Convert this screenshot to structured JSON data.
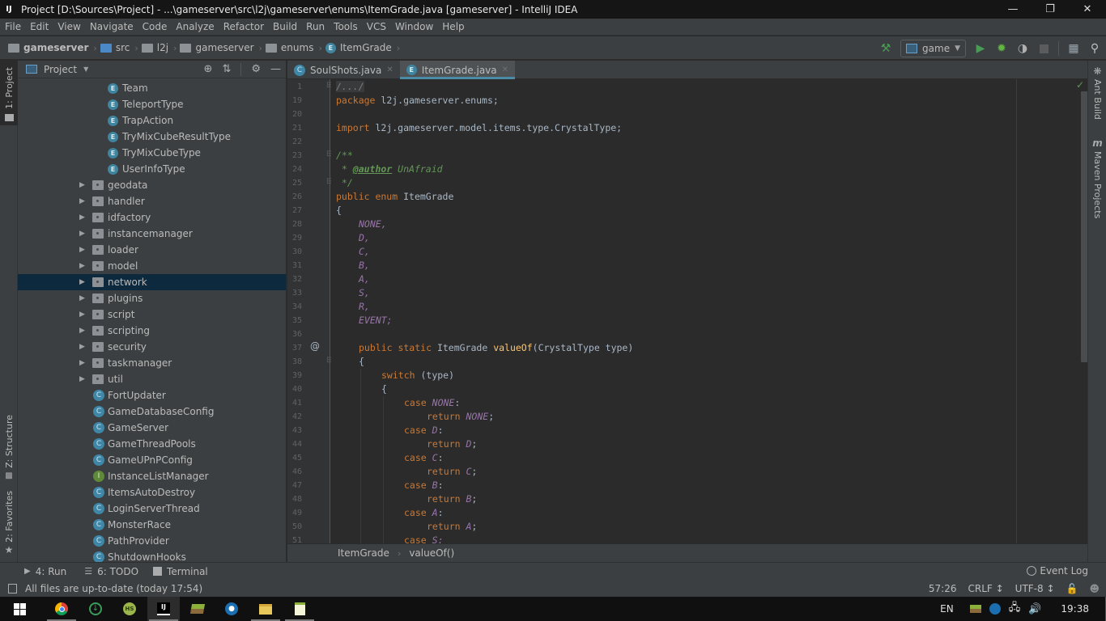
{
  "window": {
    "app_icon": "IJ",
    "title": "Project [D:\\Sources\\Project] - ...\\gameserver\\src\\l2j\\gameserver\\enums\\ItemGrade.java [gameserver] - IntelliJ IDEA",
    "controls": {
      "minimize": "—",
      "restore": "❐",
      "close": "✕"
    }
  },
  "menu": [
    {
      "label": "File"
    },
    {
      "label": "Edit"
    },
    {
      "label": "View"
    },
    {
      "label": "Navigate"
    },
    {
      "label": "Code"
    },
    {
      "label": "Analyze"
    },
    {
      "label": "Refactor"
    },
    {
      "label": "Build"
    },
    {
      "label": "Run"
    },
    {
      "label": "Tools"
    },
    {
      "label": "VCS"
    },
    {
      "label": "Window"
    },
    {
      "label": "Help"
    }
  ],
  "navbar": {
    "crumbs": [
      "gameserver",
      "src",
      "l2j",
      "gameserver",
      "enums",
      "ItemGrade"
    ],
    "run_config": "game"
  },
  "left_stripe": {
    "project": "1: Project",
    "structure": "Z: Structure",
    "favorites": "2: Favorites"
  },
  "project_panel": {
    "title": "Project",
    "enum_items": [
      "Team",
      "TeleportType",
      "TrapAction",
      "TryMixCubeResultType",
      "TryMixCubeType",
      "UserInfoType"
    ],
    "packages": [
      "geodata",
      "handler",
      "idfactory",
      "instancemanager",
      "loader",
      "model",
      "network",
      "plugins",
      "script",
      "scripting",
      "security",
      "taskmanager",
      "util"
    ],
    "selected_package": "network",
    "classes": [
      {
        "name": "FortUpdater",
        "kind": "C"
      },
      {
        "name": "GameDatabaseConfig",
        "kind": "C"
      },
      {
        "name": "GameServer",
        "kind": "C"
      },
      {
        "name": "GameThreadPools",
        "kind": "C"
      },
      {
        "name": "GameUPnPConfig",
        "kind": "C"
      },
      {
        "name": "InstanceListManager",
        "kind": "I"
      },
      {
        "name": "ItemsAutoDestroy",
        "kind": "C"
      },
      {
        "name": "LoginServerThread",
        "kind": "C"
      },
      {
        "name": "MonsterRace",
        "kind": "C"
      },
      {
        "name": "PathProvider",
        "kind": "C"
      },
      {
        "name": "ShutdownHooks",
        "kind": "C"
      }
    ]
  },
  "editor": {
    "tabs": [
      {
        "label": "SoulShots.java",
        "kind": "C",
        "active": false
      },
      {
        "label": "ItemGrade.java",
        "kind": "E",
        "active": true
      }
    ],
    "line_numbers": [
      "1",
      "19",
      "20",
      "21",
      "22",
      "23",
      "24",
      "25",
      "26",
      "27",
      "28",
      "29",
      "30",
      "31",
      "32",
      "33",
      "34",
      "35",
      "36",
      "37",
      "38",
      "39",
      "40",
      "41",
      "42",
      "43",
      "44",
      "45",
      "46",
      "47",
      "48",
      "49",
      "50",
      "51"
    ],
    "code": {
      "l1": "/.../",
      "l19_kw": "package",
      "l19_rest": " l2j.gameserver.enums;",
      "l21_kw": "import",
      "l21_rest": " l2j.gameserver.model.items.type.CrystalType;",
      "l23": "/**",
      "l24_star": " * ",
      "l24_tag": "@author",
      "l24_name": " UnAfraid",
      "l25": " */",
      "l26_kw": "public enum",
      "l26_rest": " ItemGrade",
      "l27": "{",
      "enum_constants": [
        "NONE,",
        "D,",
        "C,",
        "B,",
        "A,",
        "S,",
        "R,",
        "EVENT;"
      ],
      "l37_kw": "public static",
      "l37_type": " ItemGrade ",
      "l37_fn": "valueOf",
      "l37_rest": "(CrystalType type)",
      "l38": "{",
      "l39_kw": "switch",
      "l39_rest": " (type)",
      "l40": "{",
      "cases": [
        {
          "case_kw": "case",
          "const": "NONE",
          "ret_kw": "return",
          "ret": "NONE"
        },
        {
          "case_kw": "case",
          "const": "D",
          "ret_kw": "return",
          "ret": "D"
        },
        {
          "case_kw": "case",
          "const": "C",
          "ret_kw": "return",
          "ret": "C"
        },
        {
          "case_kw": "case",
          "const": "B",
          "ret_kw": "return",
          "ret": "B"
        },
        {
          "case_kw": "case",
          "const": "A",
          "ret_kw": "return",
          "ret": "A"
        }
      ],
      "l51_kw": "case",
      "l51_const": "S:"
    },
    "breadcrumb": [
      "ItemGrade",
      "valueOf()"
    ]
  },
  "right_stripe": {
    "ant": "Ant Build",
    "maven": "Maven Projects"
  },
  "tool_windows": {
    "run": "4: Run",
    "todo": "6: TODO",
    "terminal": "Terminal",
    "event_log": "Event Log"
  },
  "status": {
    "message": "All files are up-to-date (today 17:54)",
    "position": "57:26",
    "line_sep": "CRLF ↕",
    "encoding": "UTF-8 ↕"
  },
  "taskbar": {
    "lang": "EN",
    "time": "19:38"
  }
}
